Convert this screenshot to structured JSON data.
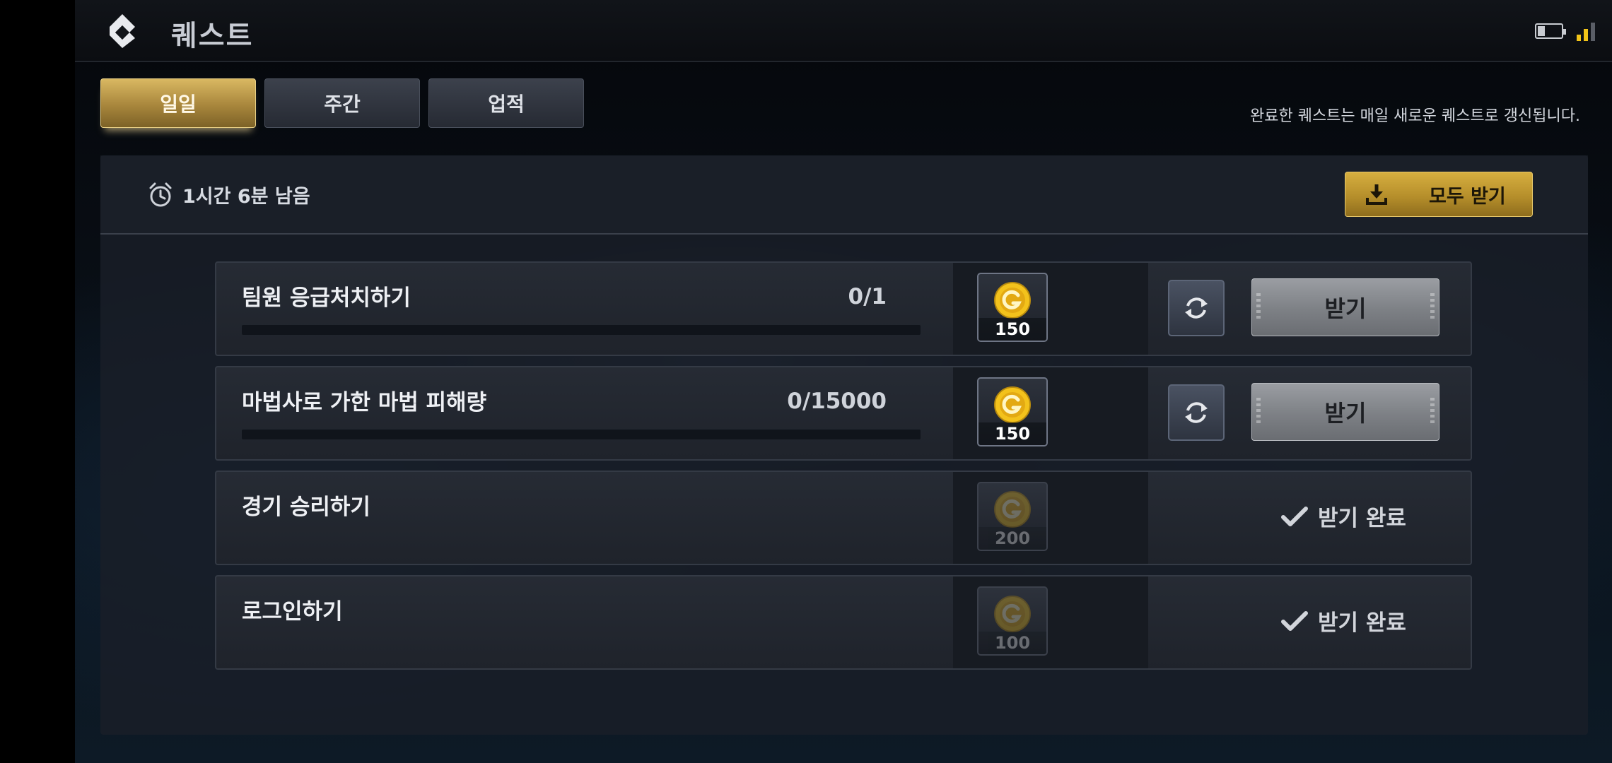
{
  "header": {
    "title": "퀘스트",
    "back_icon": "back-logo-icon"
  },
  "status_bar": {
    "battery_icon": "battery-icon",
    "signal_icon": "signal-icon"
  },
  "tabs": [
    {
      "label": "일일",
      "active": true
    },
    {
      "label": "주간",
      "active": false
    },
    {
      "label": "업적",
      "active": false
    }
  ],
  "notice": "완료한 퀘스트는 매일 새로운 퀘스트로 갱신됩니다.",
  "panel": {
    "timer_text": "1시간 6분 남음",
    "claim_all_label": "모두 받기"
  },
  "quests": [
    {
      "title": "팀원 응급처치하기",
      "progress": "0/1",
      "progress_fraction": 0,
      "reward": "150",
      "state": "claimable",
      "claim_label": "받기"
    },
    {
      "title": "마법사로 가한 마법 피해량",
      "progress": "0/15000",
      "progress_fraction": 0,
      "reward": "150",
      "state": "claimable",
      "claim_label": "받기"
    },
    {
      "title": "경기 승리하기",
      "reward": "200",
      "state": "done",
      "done_label": "받기 완료"
    },
    {
      "title": "로그인하기",
      "reward": "100",
      "state": "done",
      "done_label": "받기 완료"
    }
  ],
  "colors": {
    "gold_accent": "#d6ae3f",
    "coin": "#f5c518",
    "panel_bg": "#1a1f28"
  }
}
